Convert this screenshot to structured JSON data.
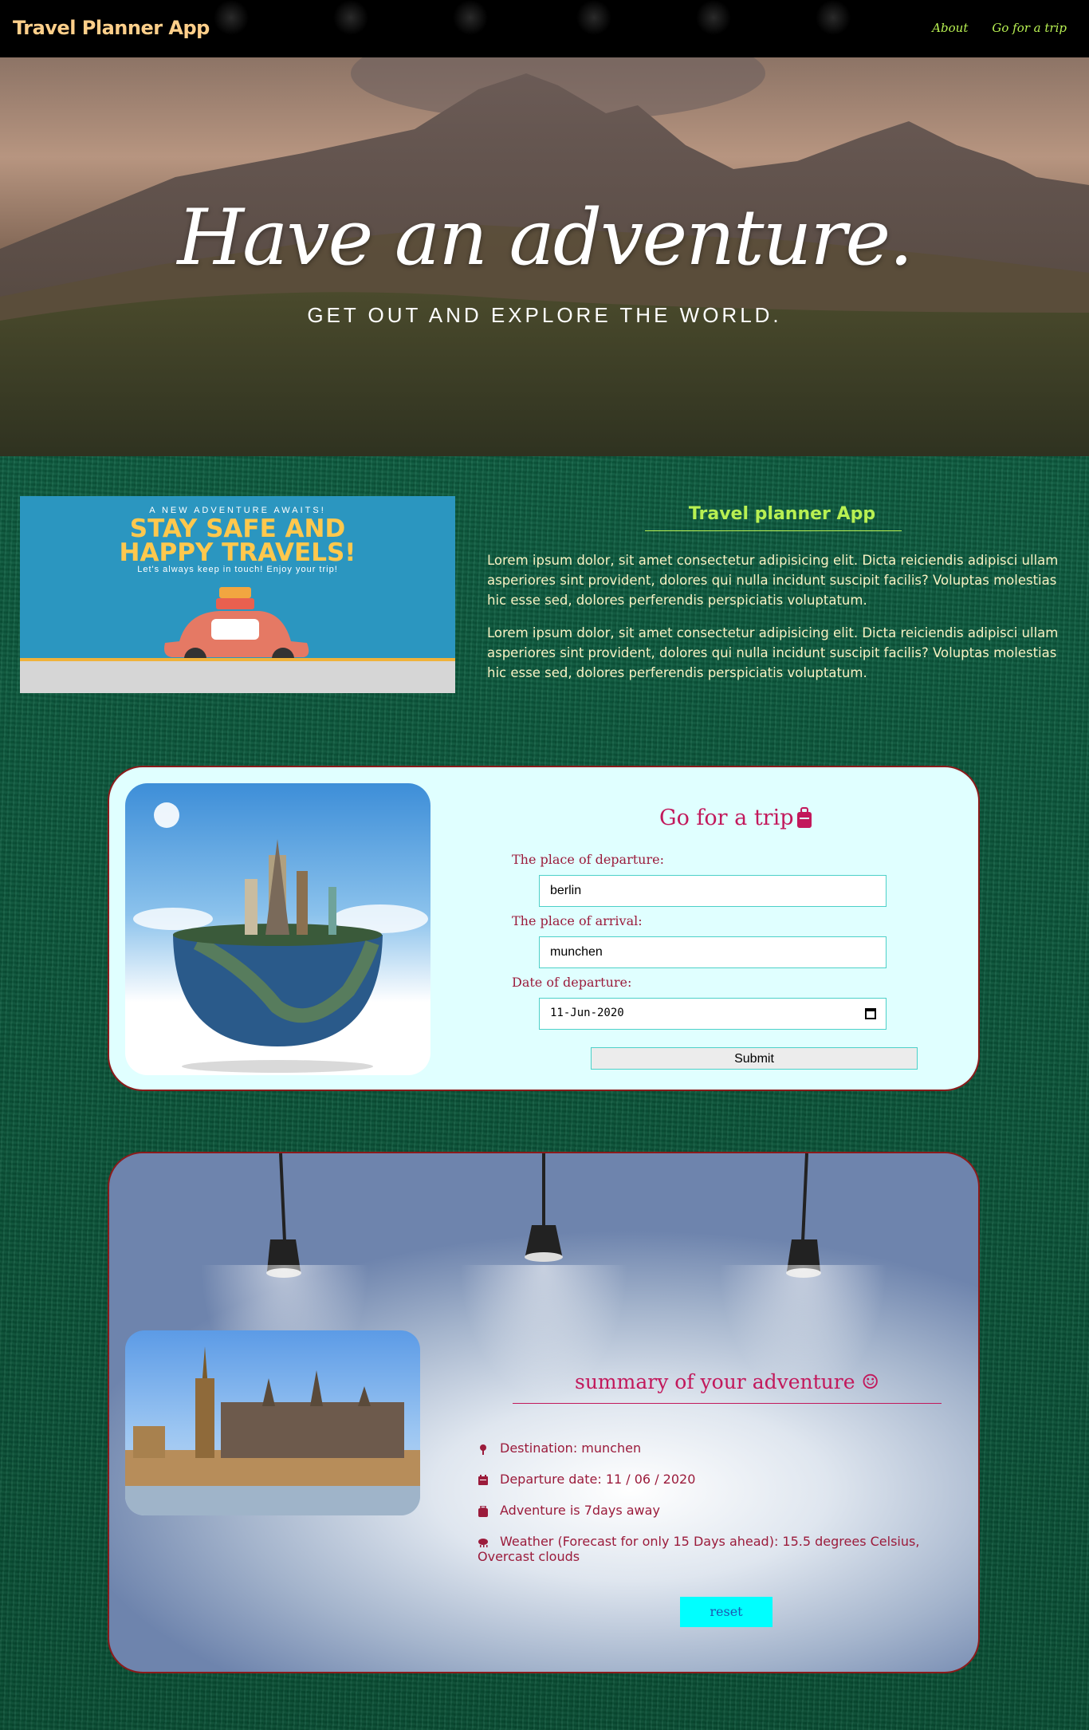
{
  "nav": {
    "brand": "Travel Planner App",
    "links": [
      {
        "label": "About"
      },
      {
        "label": "Go for a trip"
      }
    ]
  },
  "hero": {
    "title": "Have an adventure.",
    "subtitle": "GET OUT AND EXPLORE THE WORLD."
  },
  "about": {
    "image": {
      "small": "A NEW ADVENTURE AWAITS!",
      "headline1": "STAY SAFE AND",
      "headline2": "HAPPY TRAVELS!",
      "tagline": "Let's always keep in touch! Enjoy your trip!"
    },
    "title": "Travel planner App",
    "paragraphs": [
      "Lorem ipsum dolor, sit amet consectetur adipisicing elit. Dicta reiciendis adipisci ullam asperiores sint provident, dolores qui nulla incidunt suscipit facilis? Voluptas molestias hic esse sed, dolores perferendis perspiciatis voluptatum.",
      "Lorem ipsum dolor, sit amet consectetur adipisicing elit. Dicta reiciendis adipisci ullam asperiores sint provident, dolores qui nulla incidunt suscipit facilis? Voluptas molestias hic esse sed, dolores perferendis perspiciatis voluptatum."
    ]
  },
  "form": {
    "title": "Go for a trip",
    "departure_label": "The place of departure:",
    "departure_value": "berlin",
    "arrival_label": "The place of arrival:",
    "arrival_value": "munchen",
    "date_label": "Date of departure:",
    "date_value": "11-Jun-2020",
    "submit_label": "Submit"
  },
  "summary": {
    "title": "summary of your adventure ☺",
    "destination": "Destination: munchen",
    "departure_date": "Departure date: 11 / 06 / 2020",
    "days_away": "Adventure is 7days away",
    "weather": "Weather (Forecast for only 15 Days ahead): 15.5 degrees Celsius, Overcast clouds",
    "reset_label": "reset"
  },
  "colors": {
    "accent_green": "#b8f052",
    "form_title": "#c2185b",
    "label": "#9b1b3b",
    "reset_bg": "#00ffff"
  }
}
